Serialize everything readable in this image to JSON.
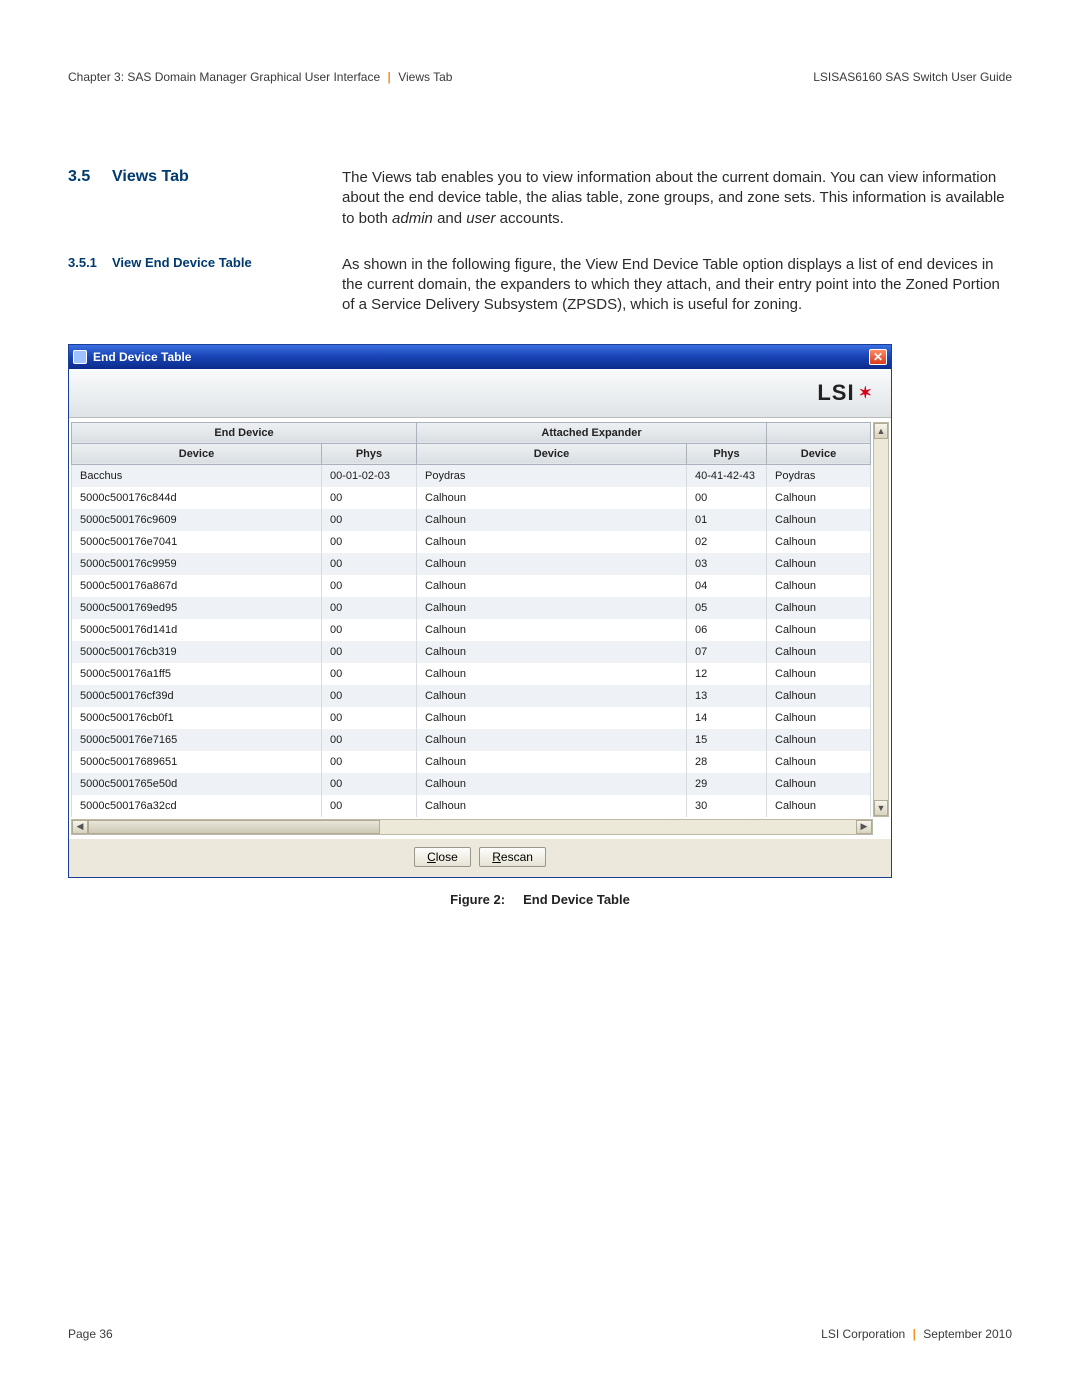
{
  "header": {
    "left_prefix": "Chapter 3: SAS Domain Manager Graphical User Interface",
    "left_suffix": "Views Tab",
    "right": "LSISAS6160 SAS Switch User Guide"
  },
  "section": {
    "num": "3.5",
    "title": "Views Tab",
    "body": "The Views tab enables you to view information about the current domain. You can view information about the end device table, the alias table, zone groups, and zone sets. This information is available to both admin and user accounts.",
    "body_em1": "admin",
    "body_em2": "user"
  },
  "subsection": {
    "num": "3.5.1",
    "title": "View End Device Table",
    "body": "As shown in the following figure, the View End Device Table option displays a list of end devices in the current domain, the expanders to which they attach, and their entry point into the Zoned Portion of a Service Delivery Subsystem (ZPSDS), which is useful for zoning."
  },
  "window": {
    "title": "End Device Table",
    "logo": "LSI",
    "group_headers": [
      "End Device",
      "Attached Expander",
      ""
    ],
    "col_headers": [
      "Device",
      "Phys",
      "Device",
      "Phys",
      "Device"
    ],
    "rows": [
      [
        "Bacchus",
        "00-01-02-03",
        "Poydras",
        "40-41-42-43",
        "Poydras"
      ],
      [
        "5000c500176c844d",
        "00",
        "Calhoun",
        "00",
        "Calhoun"
      ],
      [
        "5000c500176c9609",
        "00",
        "Calhoun",
        "01",
        "Calhoun"
      ],
      [
        "5000c500176e7041",
        "00",
        "Calhoun",
        "02",
        "Calhoun"
      ],
      [
        "5000c500176c9959",
        "00",
        "Calhoun",
        "03",
        "Calhoun"
      ],
      [
        "5000c500176a867d",
        "00",
        "Calhoun",
        "04",
        "Calhoun"
      ],
      [
        "5000c5001769ed95",
        "00",
        "Calhoun",
        "05",
        "Calhoun"
      ],
      [
        "5000c500176d141d",
        "00",
        "Calhoun",
        "06",
        "Calhoun"
      ],
      [
        "5000c500176cb319",
        "00",
        "Calhoun",
        "07",
        "Calhoun"
      ],
      [
        "5000c500176a1ff5",
        "00",
        "Calhoun",
        "12",
        "Calhoun"
      ],
      [
        "5000c500176cf39d",
        "00",
        "Calhoun",
        "13",
        "Calhoun"
      ],
      [
        "5000c500176cb0f1",
        "00",
        "Calhoun",
        "14",
        "Calhoun"
      ],
      [
        "5000c500176e7165",
        "00",
        "Calhoun",
        "15",
        "Calhoun"
      ],
      [
        "5000c50017689651",
        "00",
        "Calhoun",
        "28",
        "Calhoun"
      ],
      [
        "5000c5001765e50d",
        "00",
        "Calhoun",
        "29",
        "Calhoun"
      ],
      [
        "5000c500176a32cd",
        "00",
        "Calhoun",
        "30",
        "Calhoun"
      ]
    ],
    "buttons": {
      "close": "Close",
      "rescan": "Rescan"
    }
  },
  "figure": {
    "label": "Figure 2:",
    "title": "End Device Table"
  },
  "footer": {
    "left": "Page 36",
    "right_prefix": "LSI Corporation",
    "right_suffix": "September 2010"
  }
}
